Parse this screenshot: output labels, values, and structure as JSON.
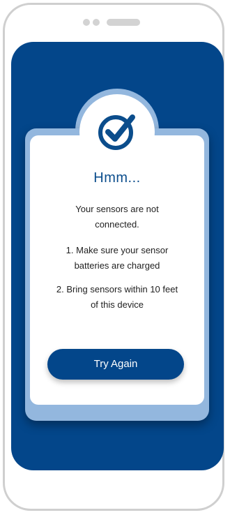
{
  "dialog": {
    "title": "Hmm...",
    "message": "Your sensors are not connected.",
    "step1": "1. Make sure your sensor batteries are charged",
    "step2": "2. Bring sensors within 10 feet of this device",
    "button_label": "Try Again",
    "icon": "check-circle-icon"
  },
  "colors": {
    "screen_bg": "#03468a",
    "card_back": "#93b7de",
    "accent": "#0b4d8c"
  }
}
